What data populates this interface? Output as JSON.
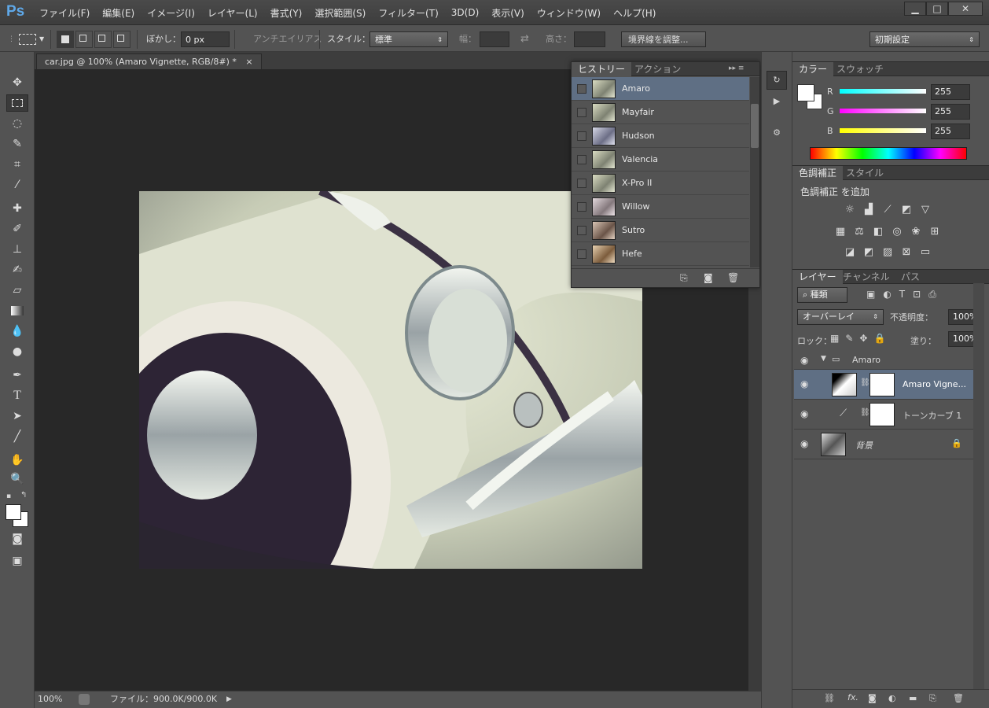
{
  "app": {
    "logo": "Ps",
    "menu": [
      "ファイル(F)",
      "編集(E)",
      "イメージ(I)",
      "レイヤー(L)",
      "書式(Y)",
      "選択範囲(S)",
      "フィルター(T)",
      "3D(D)",
      "表示(V)",
      "ウィンドウ(W)",
      "ヘルプ(H)"
    ]
  },
  "window_controls": {
    "minimize": "▁",
    "maximize": "□",
    "close": "✕"
  },
  "options": {
    "blur_label": "ぼかし：",
    "blur_value": "0 px",
    "antialias_label": "アンチエイリアス",
    "style_label": "スタイル：",
    "style_value": "標準",
    "width_label": "幅：",
    "height_label": "高さ：",
    "refine_button": "境界線を調整...",
    "workspace": "初期設定"
  },
  "document": {
    "tab_title": "car.jpg @ 100% (Amaro Vignette, RGB/8#) *",
    "close": "×"
  },
  "status": {
    "zoom": "100%",
    "file_info": "ファイル：900.0K/900.0K"
  },
  "history": {
    "tabs": [
      "ヒストリー",
      "アクション"
    ],
    "items": [
      {
        "label": "Amaro"
      },
      {
        "label": "Mayfair"
      },
      {
        "label": "Hudson"
      },
      {
        "label": "Valencia"
      },
      {
        "label": "X-Pro II"
      },
      {
        "label": "Willow"
      },
      {
        "label": "Sutro"
      },
      {
        "label": "Hefe"
      }
    ]
  },
  "color_panel": {
    "tabs": [
      "カラー",
      "スウォッチ"
    ],
    "r_label": "R",
    "g_label": "G",
    "b_label": "B",
    "r": "255",
    "g": "255",
    "b": "255"
  },
  "adjust_panel": {
    "tabs": [
      "色調補正",
      "スタイル"
    ],
    "heading": "色調補正 を追加"
  },
  "layers_panel": {
    "tabs": [
      "レイヤー",
      "チャンネル",
      "パス"
    ],
    "filter_label": "種類",
    "blend_mode": "オーバーレイ",
    "opacity_label": "不透明度：",
    "opacity": "100%",
    "lock_label": "ロック：",
    "fill_label": "塗り：",
    "fill": "100%",
    "group_name": "Amaro",
    "layers": [
      {
        "name": "Amaro Vigne..."
      },
      {
        "name": "トーンカーブ 1"
      },
      {
        "name": "背景"
      }
    ]
  },
  "colors": {
    "accent_select": "#5f6f84",
    "ps_blue": "#5fa8e8"
  }
}
